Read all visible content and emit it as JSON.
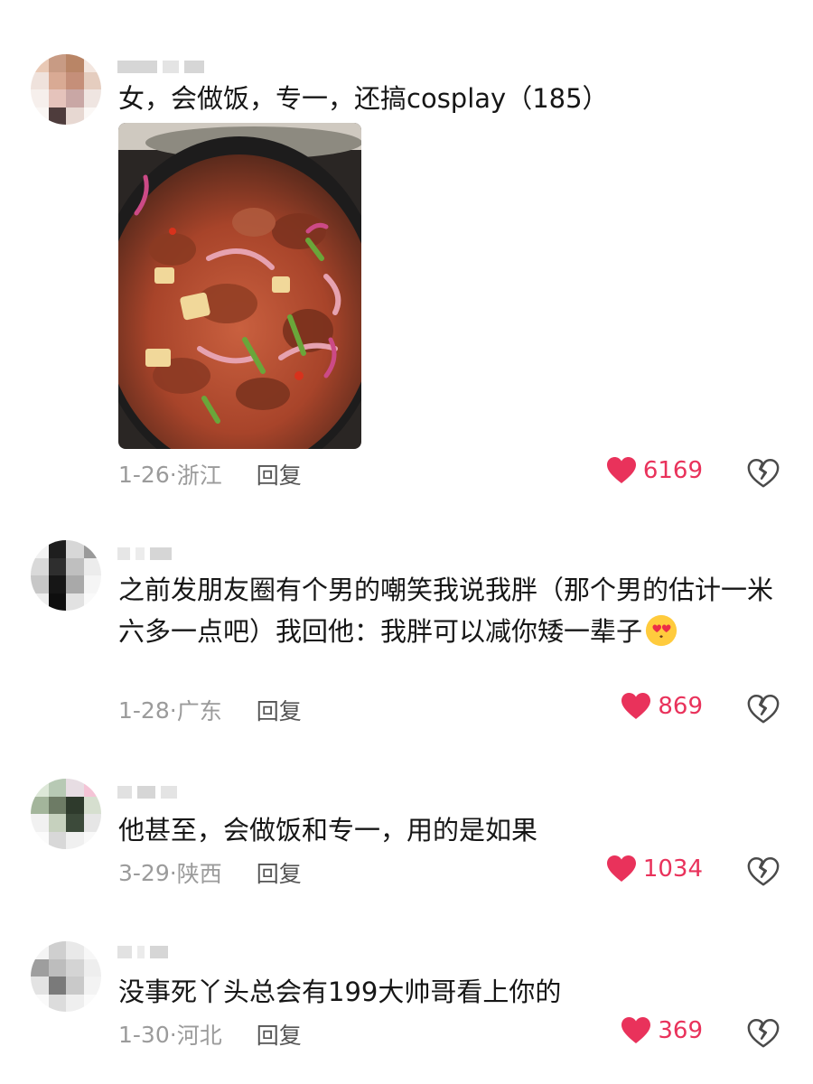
{
  "accent_color": "#e9325b",
  "comments": [
    {
      "text": "女，会做饭，专一，还搞cosplay（185）",
      "has_image": true,
      "image_description": "food-photo",
      "date": "1-26",
      "location": "浙江",
      "reply_label": "回复",
      "likes": "6169",
      "like_icon": "heart-icon",
      "dislike_icon": "broken-heart-icon"
    },
    {
      "text": "之前发朋友圈有个男的嘲笑我说我胖（那个男的估计一米六多一点吧）我回他：我胖可以减你矮一辈子",
      "emoji": "heart-eyes-emoji",
      "date": "1-28",
      "location": "广东",
      "reply_label": "回复",
      "likes": "869",
      "like_icon": "heart-icon",
      "dislike_icon": "broken-heart-icon"
    },
    {
      "text": "他甚至，会做饭和专一，用的是如果",
      "date": "3-29",
      "location": "陕西",
      "reply_label": "回复",
      "likes": "1034",
      "like_icon": "heart-icon",
      "dislike_icon": "broken-heart-icon"
    },
    {
      "text": "没事死丫头总会有199大帅哥看上你的",
      "date": "1-30",
      "location": "河北",
      "reply_label": "回复",
      "likes": "369",
      "like_icon": "heart-icon",
      "dislike_icon": "broken-heart-icon"
    }
  ]
}
